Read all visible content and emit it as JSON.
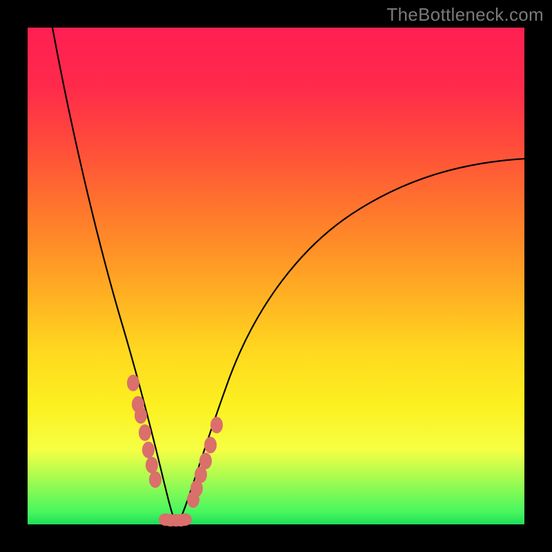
{
  "watermark": "TheBottleneck.com",
  "colors": {
    "background": "#000000",
    "gradient_top": "#ff2052",
    "gradient_mid": "#ffd81f",
    "gradient_green": "#1fdc57",
    "curve": "#000000",
    "dot": "#da6f6c"
  },
  "chart_data": {
    "type": "line",
    "title": "",
    "xlabel": "",
    "ylabel": "",
    "xlim": [
      0,
      100
    ],
    "ylim": [
      0,
      100
    ],
    "legend": false,
    "grid": false,
    "annotations": [
      "TheBottleneck.com"
    ],
    "series": [
      {
        "name": "left-branch",
        "note": "descending curve from upper-left toward the minimum",
        "x": [
          5,
          7,
          9,
          11,
          13,
          15,
          17,
          19,
          21,
          22.5,
          24,
          25.5,
          27,
          28.5,
          29.5
        ],
        "y": [
          100,
          92,
          83,
          74,
          64,
          55,
          46,
          36,
          26,
          19,
          13,
          8,
          4,
          1.5,
          0.6
        ]
      },
      {
        "name": "right-branch",
        "note": "ascending curve from the minimum toward upper-right",
        "x": [
          30.5,
          32,
          34,
          36.5,
          40,
          45,
          50,
          56,
          63,
          70,
          78,
          86,
          94,
          100
        ],
        "y": [
          0.6,
          1.8,
          5,
          10,
          17,
          26,
          34,
          42,
          50,
          56.5,
          62.5,
          67,
          70.5,
          72
        ]
      },
      {
        "name": "marker-dots",
        "note": "salmon dots clustered near and along the minimum",
        "x": [
          21.3,
          22.2,
          22.8,
          23.6,
          24.3,
          25.0,
          25.7,
          27.8,
          28.8,
          29.8,
          30.8,
          31.6,
          33.3,
          34.0,
          34.9,
          35.8,
          36.8,
          38.1
        ],
        "y": [
          28.5,
          24.2,
          22.0,
          18.5,
          15.0,
          12.0,
          9.0,
          1.0,
          0.8,
          0.8,
          0.8,
          1.0,
          5.0,
          7.2,
          10.0,
          12.8,
          16.0,
          20.0
        ]
      }
    ]
  }
}
